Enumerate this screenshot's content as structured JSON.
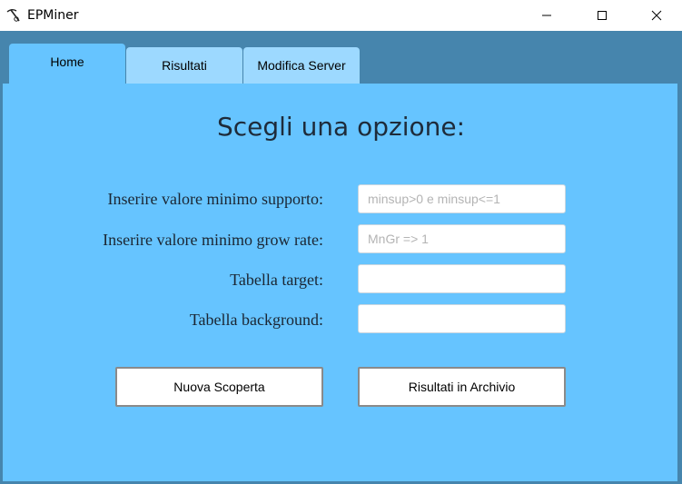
{
  "window": {
    "title": "EPMiner",
    "icon": "pickaxe-icon"
  },
  "tabs": [
    {
      "label": "Home",
      "selected": true
    },
    {
      "label": "Risultati",
      "selected": false
    },
    {
      "label": "Modifica Server",
      "selected": false
    }
  ],
  "home": {
    "heading": "Scegli una opzione:",
    "fields": [
      {
        "label": "Inserire valore minimo supporto:",
        "value": "",
        "placeholder": "minsup>0 e minsup<=1"
      },
      {
        "label": "Inserire valore minimo grow rate:",
        "value": "",
        "placeholder": "MnGr => 1"
      },
      {
        "label": "Tabella target:",
        "value": "",
        "placeholder": ""
      },
      {
        "label": "Tabella background:",
        "value": "",
        "placeholder": ""
      }
    ],
    "buttons": {
      "nuova_scoperta": "Nuova Scoperta",
      "risultati_archivio": "Risultati in Archivio"
    }
  },
  "colors": {
    "window_frame": "#4685ad",
    "panel": "#66c4ff",
    "tab_inactive": "#9dd9ff"
  }
}
